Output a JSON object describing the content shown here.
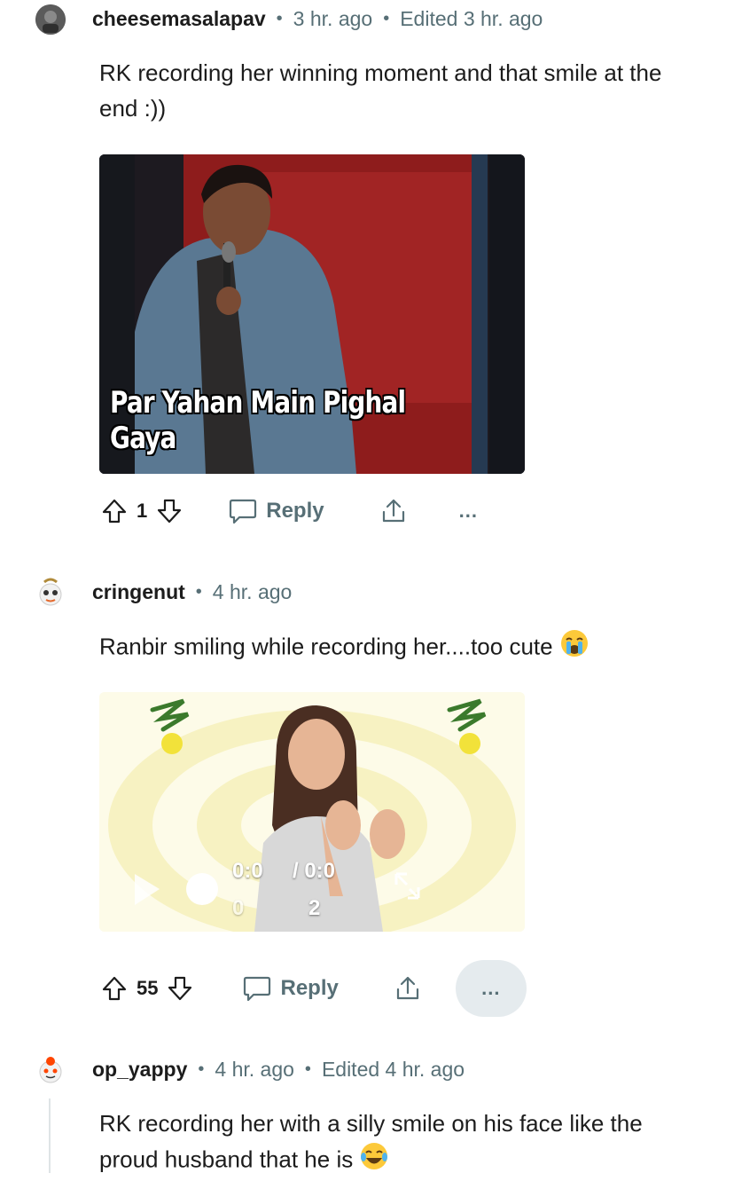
{
  "comments": [
    {
      "username": "cheesemasalapav",
      "time": "3 hr. ago",
      "edited": "Edited 3 hr. ago",
      "text": "RK recording her winning moment and that smile at the end :))",
      "media_caption": "Par Yahan Main Pighal Gaya",
      "score": "1",
      "reply_label": "Reply",
      "more_label": "..."
    },
    {
      "username": "cringenut",
      "time": "4 hr. ago",
      "text": "Ranbir smiling while recording her....too cute",
      "text_emoji": "loudly-crying-face-emoji",
      "video": {
        "current_time": "0:0",
        "duration": "/ 0:0",
        "extra": "2",
        "extra_left": "0"
      },
      "score": "55",
      "reply_label": "Reply",
      "more_label": "..."
    },
    {
      "username": "op_yappy",
      "time": "4 hr. ago",
      "edited": "Edited 4 hr. ago",
      "text": "RK recording her with a silly smile on his face like the proud husband that he is",
      "text_emoji": "face-with-tears-of-joy-emoji"
    }
  ],
  "colors": {
    "meta_gray": "#576f76",
    "text": "#1c1c1c",
    "pill_bg": "#e5ebee",
    "thread_line": "#dfe4e6"
  }
}
